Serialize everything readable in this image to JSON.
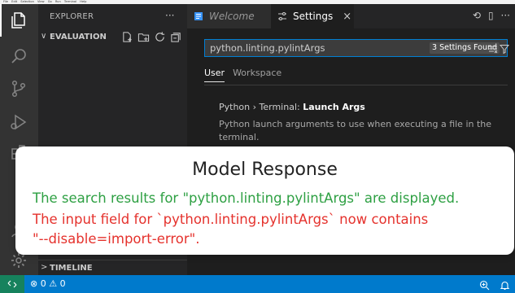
{
  "menubar": [
    "File",
    "Edit",
    "Selection",
    "View",
    "Go",
    "Run",
    "Terminal",
    "Help"
  ],
  "activity": {
    "icons": [
      "explorer-icon",
      "search-icon",
      "source-control-icon",
      "run-debug-icon",
      "extensions-icon",
      "accounts-icon",
      "manage-gear-icon"
    ]
  },
  "sidebar": {
    "title": "EXPLORER",
    "more": "···",
    "folder": "EVALUATION",
    "folder_chevron": "∨",
    "timeline": "TIMELINE",
    "timeline_chevron": ">"
  },
  "tabs": {
    "welcome": "Welcome",
    "settings": "Settings",
    "close": "×",
    "actions": [
      "⟲",
      "▯",
      "···"
    ]
  },
  "settings": {
    "search_value": "python.linting.pylintArgs",
    "count": "3 Settings Found",
    "scope_user": "User",
    "scope_workspace": "Workspace",
    "setting_prefix": "Python › Terminal: ",
    "setting_name": "Launch Args",
    "setting_desc": "Python launch arguments to use when executing a file in the terminal."
  },
  "status": {
    "problems": "⊗ 0 ⚠ 0"
  },
  "overlay": {
    "title": "Model Response",
    "line1": "The search results for \"python.linting.pylintArgs\" are displayed.",
    "line2": "The input field for `python.linting.pylintArgs` now contains",
    "line3": "\"--disable=import-error\".",
    "colors": {
      "success": "#2ea043",
      "error": "#e5322d"
    }
  },
  "colors": {
    "accent": "#007acc",
    "remote": "#16825d",
    "focus": "#007fd4"
  }
}
